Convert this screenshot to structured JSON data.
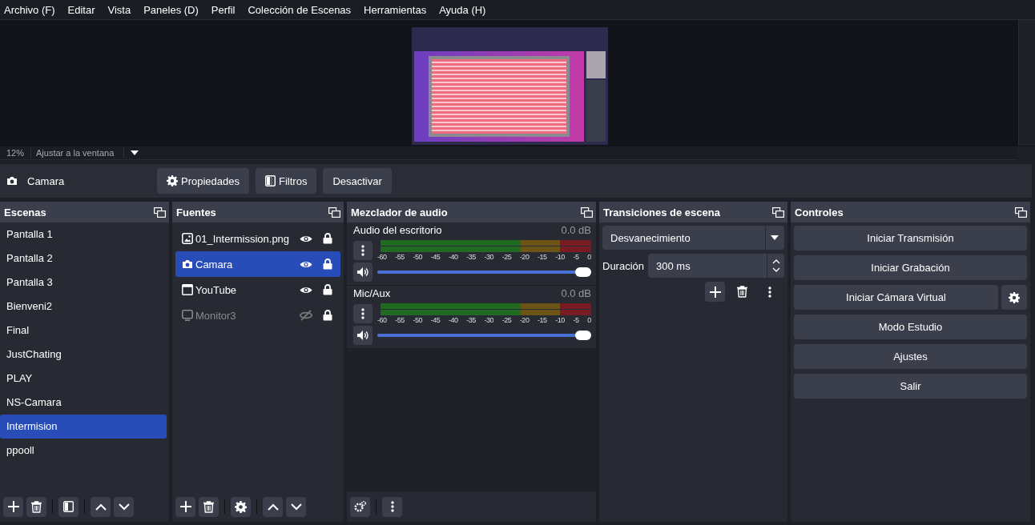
{
  "menu": [
    "Archivo (F)",
    "Editar",
    "Vista",
    "Paneles (D)",
    "Perfil",
    "Colección de Escenas",
    "Herramientas",
    "Ayuda (H)"
  ],
  "preview": {
    "zoom": "12%",
    "fit": "Ajustar a la ventana"
  },
  "source_toolbar": {
    "source": "Camara",
    "buttons": [
      "Propiedades",
      "Filtros",
      "Desactivar"
    ]
  },
  "scenes": {
    "title": "Escenas",
    "items": [
      {
        "name": "Pantalla 1",
        "selected": false
      },
      {
        "name": "Pantalla 2",
        "selected": false
      },
      {
        "name": "Pantalla 3",
        "selected": false
      },
      {
        "name": "Bienveni2",
        "selected": false
      },
      {
        "name": "Final",
        "selected": false
      },
      {
        "name": "JustChating",
        "selected": false
      },
      {
        "name": "PLAY",
        "selected": false
      },
      {
        "name": "NS-Camara",
        "selected": false
      },
      {
        "name": "Intermision",
        "selected": true
      },
      {
        "name": "ppooll",
        "selected": false
      }
    ]
  },
  "sources": {
    "title": "Fuentes",
    "items": [
      {
        "name": "01_Intermission.png",
        "kind": "image",
        "visible": true,
        "locked": true,
        "selected": false
      },
      {
        "name": "Camara",
        "kind": "camera",
        "visible": true,
        "locked": true,
        "selected": true
      },
      {
        "name": "YouTube",
        "kind": "browser",
        "visible": true,
        "locked": true,
        "selected": false
      },
      {
        "name": "Monitor3",
        "kind": "display",
        "visible": false,
        "locked": true,
        "selected": false
      }
    ]
  },
  "mixer": {
    "title": "Mezclador de audio",
    "channels": [
      {
        "name": "Audio del escritorio",
        "reading": "0.0 dB",
        "scale": [
          "-60",
          "-55",
          "-50",
          "-45",
          "-40",
          "-35",
          "-30",
          "-25",
          "-20",
          "-15",
          "-10",
          "-5",
          "0"
        ],
        "level": 1
      },
      {
        "name": "Mic/Aux",
        "reading": "0.0 dB",
        "scale": [
          "-60",
          "-55",
          "-50",
          "-45",
          "-40",
          "-35",
          "-30",
          "-25",
          "-20",
          "-15",
          "-10",
          "-5",
          "0"
        ],
        "level": 1
      }
    ]
  },
  "transitions": {
    "title": "Transiciones de escena",
    "transition": "Desvanecimiento",
    "duration_label": "Duración",
    "duration": "300 ms"
  },
  "controls": {
    "title": "Controles",
    "buttons": [
      "Iniciar Transmisión",
      "Iniciar Grabación",
      "Iniciar Cámara Virtual",
      "Modo Estudio",
      "Ajustes",
      "Salir"
    ]
  }
}
